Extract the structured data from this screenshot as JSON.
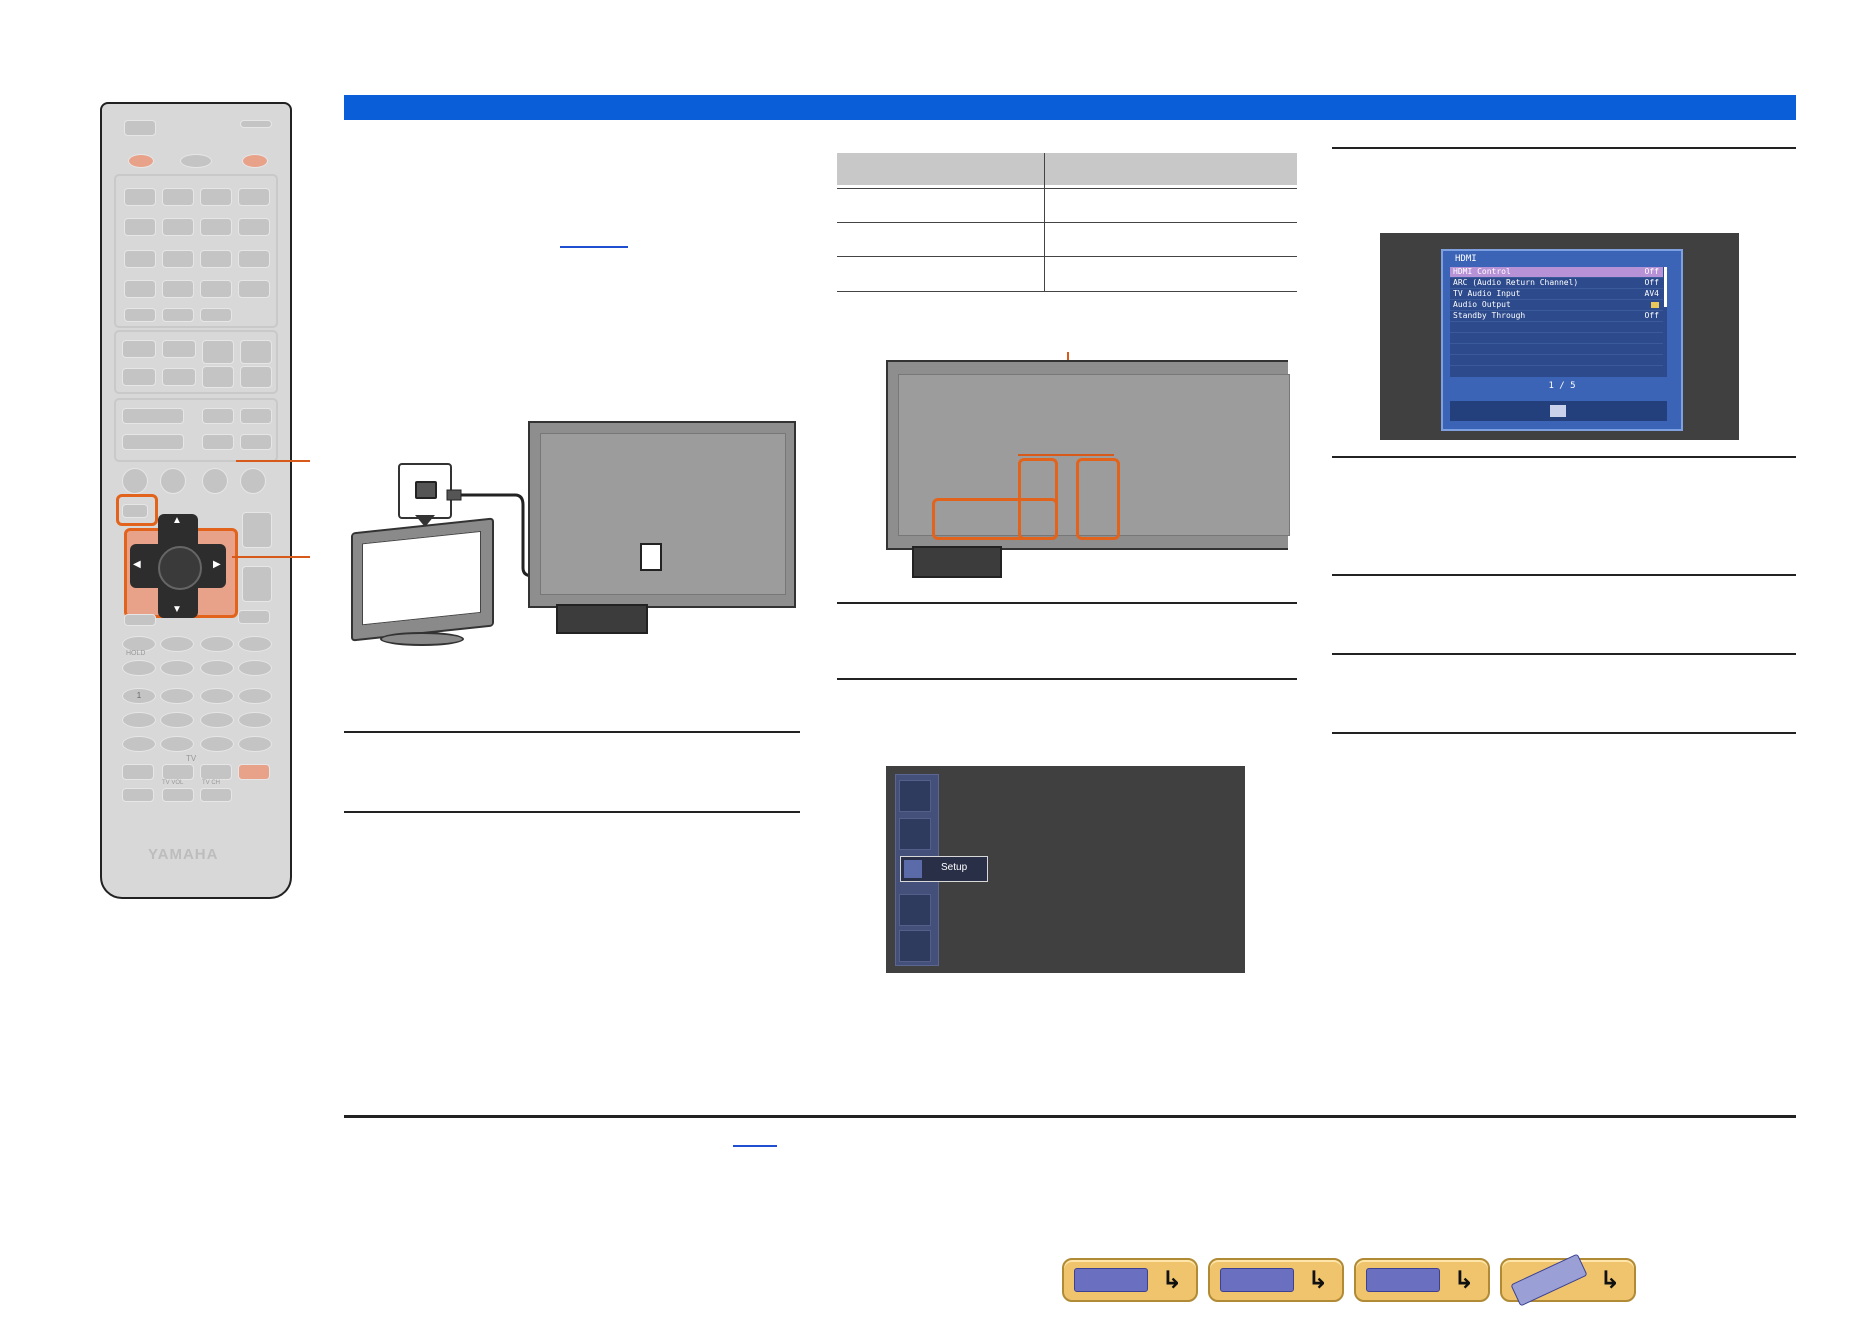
{
  "remote": {
    "brand": "YAMAHA",
    "labels": {
      "hold": "HOLD",
      "tv": "TV",
      "tv_vol": "TV VOL",
      "tv_ch": "TV CH",
      "one": "1"
    },
    "colors": {
      "highlight": "#e2631c",
      "power": "#e9a28a"
    }
  },
  "header_bar": {
    "color": "#0a5fd9"
  },
  "setup_menu": {
    "selected_label": "Setup"
  },
  "hdmi_screen": {
    "title": "HDMI",
    "rows": [
      {
        "label": "HDMI Control",
        "value": "Off"
      },
      {
        "label": "ARC (Audio Return Channel)",
        "value": "Off"
      },
      {
        "label": "TV Audio Input",
        "value": "AV4"
      },
      {
        "label": "Audio Output",
        "value": ""
      },
      {
        "label": "Standby Through",
        "value": "Off"
      }
    ],
    "page": "1 / 5"
  },
  "nav_buttons": [
    {
      "name": "front-panel",
      "icon": "receiver-front-icon"
    },
    {
      "name": "rear-panel",
      "icon": "receiver-rear-icon"
    },
    {
      "name": "front-display",
      "icon": "front-display-icon"
    },
    {
      "name": "remote-control",
      "icon": "remote-control-icon"
    }
  ]
}
